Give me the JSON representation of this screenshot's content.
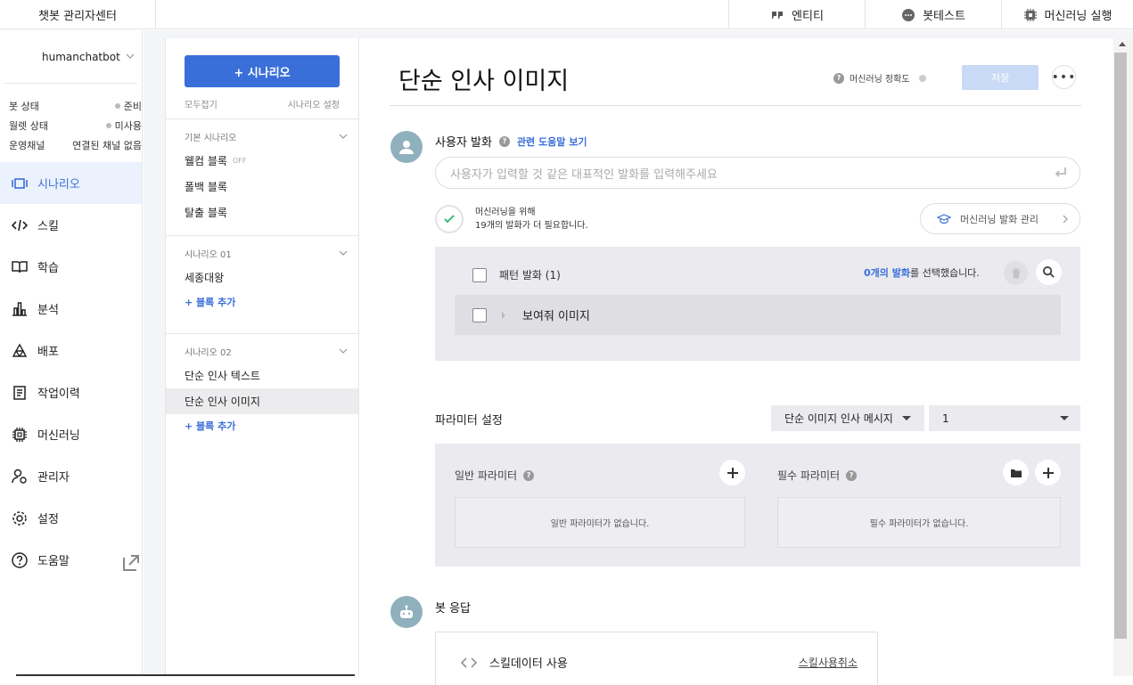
{
  "brand": "챗봇 관리자센터",
  "topnav": [
    {
      "label": "엔티티",
      "icon": "quote-icon"
    },
    {
      "label": "봇테스트",
      "icon": "chat-bubble-icon"
    },
    {
      "label": "머신러닝 실행",
      "icon": "chip-icon"
    }
  ],
  "bot": {
    "name": "humanchatbot",
    "status": [
      {
        "label": "봇 상태",
        "value": "준비"
      },
      {
        "label": "월렛 상태",
        "value": "미사용"
      },
      {
        "label": "운영채널",
        "value": "연결된 채널 없음"
      }
    ]
  },
  "sidebar": {
    "items": [
      {
        "label": "시나리오",
        "icon": "scenario-icon",
        "active": true
      },
      {
        "label": "스킬",
        "icon": "code-icon"
      },
      {
        "label": "학습",
        "icon": "book-icon"
      },
      {
        "label": "분석",
        "icon": "bar-chart-icon"
      },
      {
        "label": "배포",
        "icon": "deploy-icon"
      },
      {
        "label": "작업이력",
        "icon": "history-icon"
      },
      {
        "label": "머신러닝",
        "icon": "chip-icon"
      },
      {
        "label": "관리자",
        "icon": "admin-icon"
      },
      {
        "label": "설정",
        "icon": "gear-icon"
      },
      {
        "label": "도움말",
        "icon": "help-icon"
      }
    ]
  },
  "scenarios": {
    "add_label": "+ 시나리오",
    "collapse_all": "모두접기",
    "settings": "시나리오 설정",
    "groups": [
      {
        "title": "기본 시나리오",
        "items": [
          {
            "label": "웰컴 블록",
            "badge": "OFF"
          },
          {
            "label": "폴백 블록"
          },
          {
            "label": "탈출 블록"
          }
        ],
        "add": ""
      },
      {
        "title": "시나리오 01",
        "items": [
          {
            "label": "세종대왕"
          }
        ],
        "add": "+ 블록 추가"
      },
      {
        "title": "시나리오 02",
        "items": [
          {
            "label": "단순 인사 텍스트"
          },
          {
            "label": "단순 인사 이미지",
            "selected": true
          }
        ],
        "add": "+ 블록 추가"
      }
    ]
  },
  "main": {
    "title": "단순 인사 이미지",
    "accuracy": "머신러닝 정확도",
    "save": "저장",
    "more": "•••",
    "user_utterance": {
      "title": "사용자 발화",
      "help_link": "관련 도움말 보기",
      "placeholder": "사용자가 입력할 것 같은 대표적인 발화를 입력해주세요",
      "ml_line1": "머신러닝을 위해",
      "ml_line2": "19개의 발화가 더 필요합니다.",
      "ml_manage": "머신러닝 발화 관리"
    },
    "pattern": {
      "header": "패턴 발화 (1)",
      "selected_count": "0개의 발화",
      "selected_suffix": "를 선택했습니다.",
      "rows": [
        "보여줘 이미지"
      ]
    },
    "params": {
      "title": "파라미터 설정",
      "dropdown1": "단순 이미지 인사 메시지",
      "dropdown2": "1",
      "general_title": "일반 파라미터",
      "general_empty": "일반 파라미터가 없습니다.",
      "required_title": "필수 파라미터",
      "required_empty": "필수 파라미터가 없습니다."
    },
    "bot_response": {
      "title": "봇 응답",
      "skill_label": "스킬데이터 사용",
      "skill_cancel": "스킬사용취소"
    }
  }
}
